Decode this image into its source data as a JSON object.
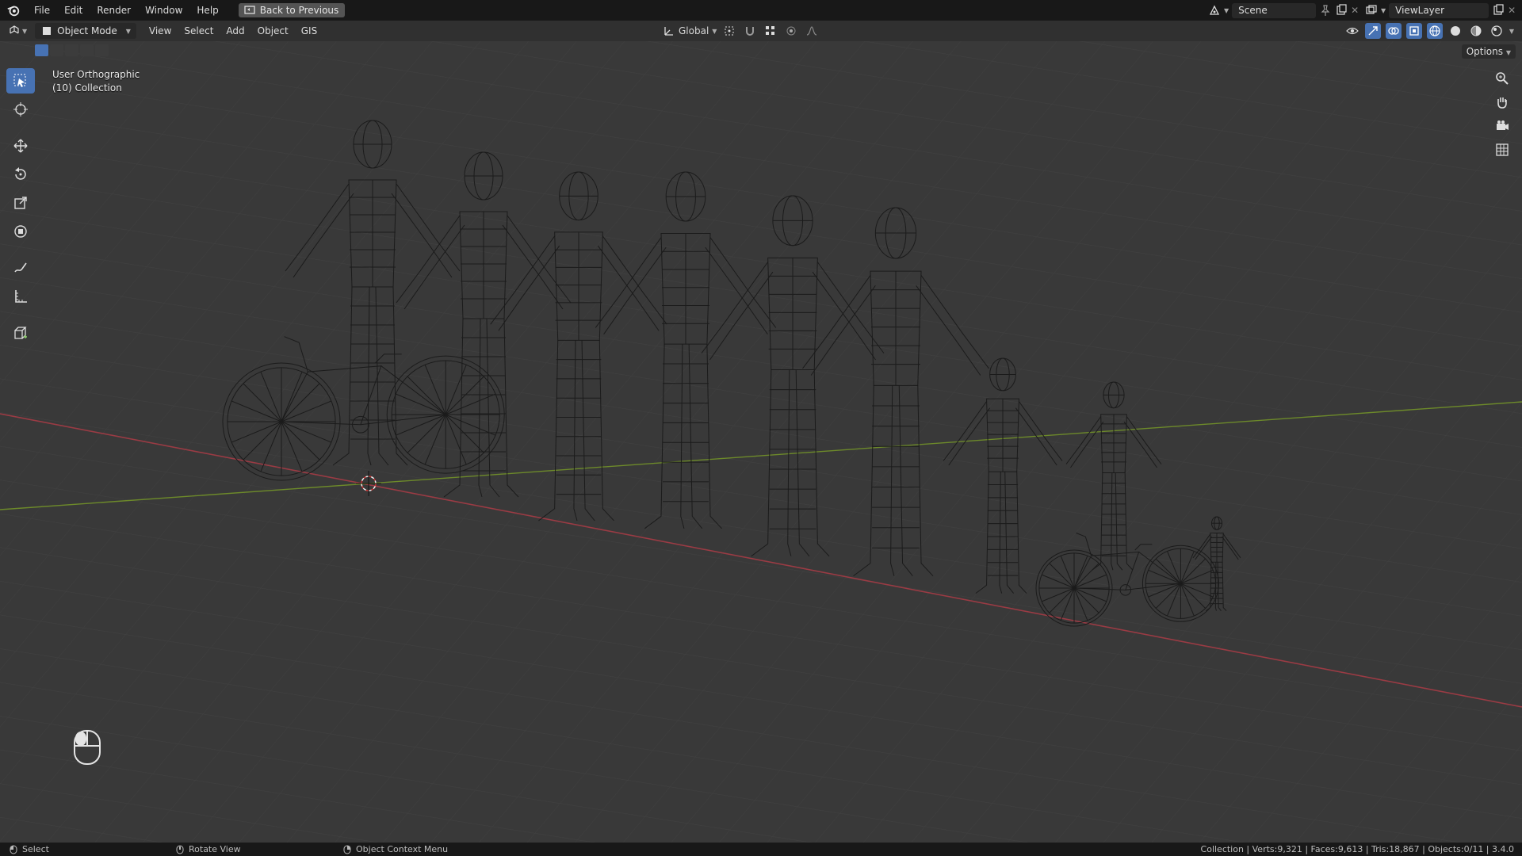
{
  "app": {
    "menus": [
      "File",
      "Edit",
      "Render",
      "Window",
      "Help"
    ],
    "back_button": "Back to Previous",
    "scene_name": "Scene",
    "view_layer": "ViewLayer"
  },
  "header": {
    "mode": "Object Mode",
    "menus": [
      "View",
      "Select",
      "Add",
      "Object",
      "GIS"
    ],
    "transform_orientation": "Global",
    "options_label": "Options"
  },
  "viewport": {
    "view_name": "User Orthographic",
    "collection": "(10) Collection",
    "grid_color": "#444444",
    "x_axis_color": "#9a3b44",
    "y_axis_color": "#6d8a2a",
    "wire_color": "#1a1a1a"
  },
  "toolbar": {
    "tools": [
      {
        "name": "select-box",
        "icon": "cursor-box-icon",
        "active": true
      },
      {
        "name": "cursor",
        "icon": "3d-cursor-icon"
      },
      {
        "name": "move",
        "icon": "move-icon"
      },
      {
        "name": "rotate",
        "icon": "rotate-icon"
      },
      {
        "name": "scale",
        "icon": "scale-icon"
      },
      {
        "name": "transform",
        "icon": "transform-icon"
      },
      {
        "name": "annotate",
        "icon": "annotate-icon"
      },
      {
        "name": "measure",
        "icon": "measure-icon"
      },
      {
        "name": "add-cube",
        "icon": "add-cube-icon"
      }
    ]
  },
  "statusbar": {
    "left_action": "Select",
    "middle_action": "Rotate View",
    "right_action": "Object Context Menu",
    "stats": "Collection | Verts:9,321 | Faces:9,613 | Tris:18,867 | Objects:0/11 | 3.4.0"
  },
  "colors": {
    "accent": "#4772b3",
    "topbar_bg": "#181818",
    "header_bg": "#303030",
    "viewport_bg": "#393939"
  }
}
